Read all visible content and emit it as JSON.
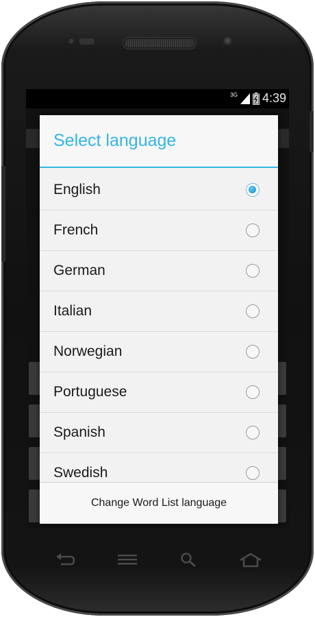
{
  "status_bar": {
    "network": "3G",
    "time": "4:39"
  },
  "dialog": {
    "title": "Select language",
    "languages": [
      {
        "label": "English",
        "selected": true
      },
      {
        "label": "French",
        "selected": false
      },
      {
        "label": "German",
        "selected": false
      },
      {
        "label": "Italian",
        "selected": false
      },
      {
        "label": "Norwegian",
        "selected": false
      },
      {
        "label": "Portuguese",
        "selected": false
      },
      {
        "label": "Spanish",
        "selected": false
      },
      {
        "label": "Swedish",
        "selected": false
      }
    ],
    "footer_label": "Change Word List language"
  },
  "nav_buttons": [
    "back-icon",
    "menu-icon",
    "search-icon",
    "home-icon"
  ],
  "colors": {
    "accent": "#33b5e5",
    "dialog_bg": "#f2f2f2",
    "device_body": "#111111"
  }
}
